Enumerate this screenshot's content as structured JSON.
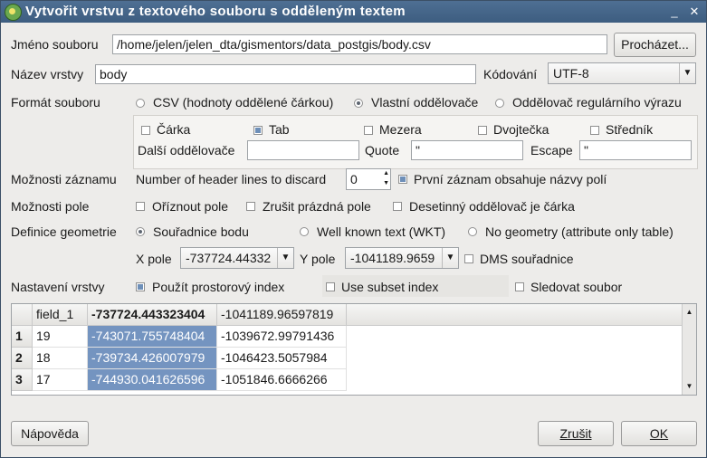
{
  "window": {
    "title": "Vytvořit vrstvu z textového souboru s odděleným textem",
    "minimize": "_",
    "close": "✕"
  },
  "file": {
    "label": "Jméno souboru",
    "value": "/home/jelen/jelen_dta/gismentors/data_postgis/body.csv",
    "browse_label": "Procházet..."
  },
  "layer": {
    "label": "Název vrstvy",
    "value": "body",
    "encoding_label": "Kódování",
    "encoding_value": "UTF-8"
  },
  "format": {
    "label": "Formát souboru",
    "options": [
      "CSV (hodnoty oddělené čárkou)",
      "Vlastní oddělovače",
      "Oddělovač regulárního výrazu"
    ],
    "selected": 1
  },
  "delimiters": {
    "comma": "Čárka",
    "tab": "Tab",
    "space": "Mezera",
    "colon": "Dvojtečka",
    "semicolon": "Středník",
    "other_label": "Další oddělovače",
    "other_value": "",
    "quote_label": "Quote",
    "quote_value": "\"",
    "escape_label": "Escape",
    "escape_value": "\""
  },
  "record": {
    "label": "Možnosti záznamu",
    "header_lines_label": "Number of header lines to discard",
    "header_lines_value": "0",
    "first_record_names": "První záznam obsahuje názvy polí"
  },
  "field_opts": {
    "label": "Možnosti pole",
    "trim": "Oříznout pole",
    "discard_empty": "Zrušit prázdná pole",
    "decimal_comma": "Desetinný oddělovač je čárka"
  },
  "geometry": {
    "label": "Definice geometrie",
    "options": [
      "Souřadnice bodu",
      "Well known text (WKT)",
      "No geometry (attribute only table)"
    ],
    "selected": 0,
    "x_label": "X pole",
    "x_value": "-737724.44332",
    "y_label": "Y pole",
    "y_value": "-1041189.9659",
    "dms": "DMS souřadnice"
  },
  "layer_settings": {
    "label": "Nastavení vrstvy",
    "spatial_index": "Použít prostorový index",
    "subset_index": "Use subset index",
    "watch_file": "Sledovat soubor"
  },
  "table": {
    "headers": [
      "field_1",
      "-737724.443323404",
      "-1041189.96597819"
    ],
    "rows": [
      {
        "num": "1",
        "cells": [
          "19",
          "-743071.755748404",
          "-1039672.99791436"
        ]
      },
      {
        "num": "2",
        "cells": [
          "18",
          "-739734.426007979",
          "-1046423.5057984"
        ]
      },
      {
        "num": "3",
        "cells": [
          "17",
          "-744930.041626596",
          "-1051846.6666266"
        ]
      }
    ]
  },
  "footer": {
    "help": "Nápověda",
    "cancel": "Zrušit",
    "ok": "OK"
  },
  "colors": {
    "titlebar": "#3d5d80",
    "selection": "#7494c0"
  }
}
